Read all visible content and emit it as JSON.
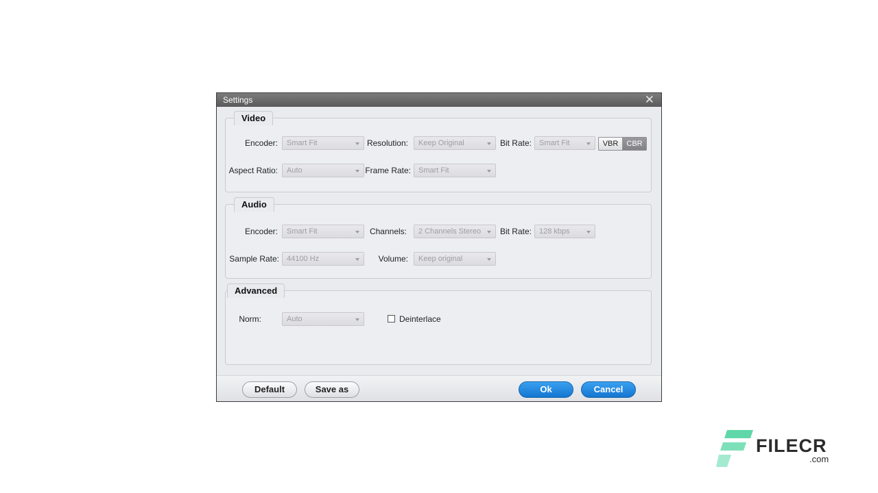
{
  "dialog": {
    "title": "Settings"
  },
  "video": {
    "title": "Video",
    "encoder_label": "Encoder:",
    "encoder_value": "Smart Fit",
    "resolution_label": "Resolution:",
    "resolution_value": "Keep Original",
    "bitrate_label": "Bit Rate:",
    "bitrate_value": "Smart Fit",
    "vbr_label": "VBR",
    "cbr_label": "CBR",
    "aspect_label": "Aspect Ratio:",
    "aspect_value": "Auto",
    "framerate_label": "Frame Rate:",
    "framerate_value": "Smart Fit"
  },
  "audio": {
    "title": "Audio",
    "encoder_label": "Encoder:",
    "encoder_value": "Smart Fit",
    "channels_label": "Channels:",
    "channels_value": "2 Channels Stereo",
    "bitrate_label": "Bit Rate:",
    "bitrate_value": "128 kbps",
    "samplerate_label": "Sample Rate:",
    "samplerate_value": "44100 Hz",
    "volume_label": "Volume:",
    "volume_value": "Keep original"
  },
  "advanced": {
    "title": "Advanced",
    "norm_label": "Norm:",
    "norm_value": "Auto",
    "deinterlace_label": "Deinterlace"
  },
  "footer": {
    "default_label": "Default",
    "saveas_label": "Save as",
    "ok_label": "Ok",
    "cancel_label": "Cancel"
  },
  "watermark": {
    "brand": "FILECR",
    "domain": ".com"
  },
  "colors": {
    "accent_blue": "#1476d0",
    "logo_green": "#4fd1a0",
    "titlebar": "#666666"
  }
}
